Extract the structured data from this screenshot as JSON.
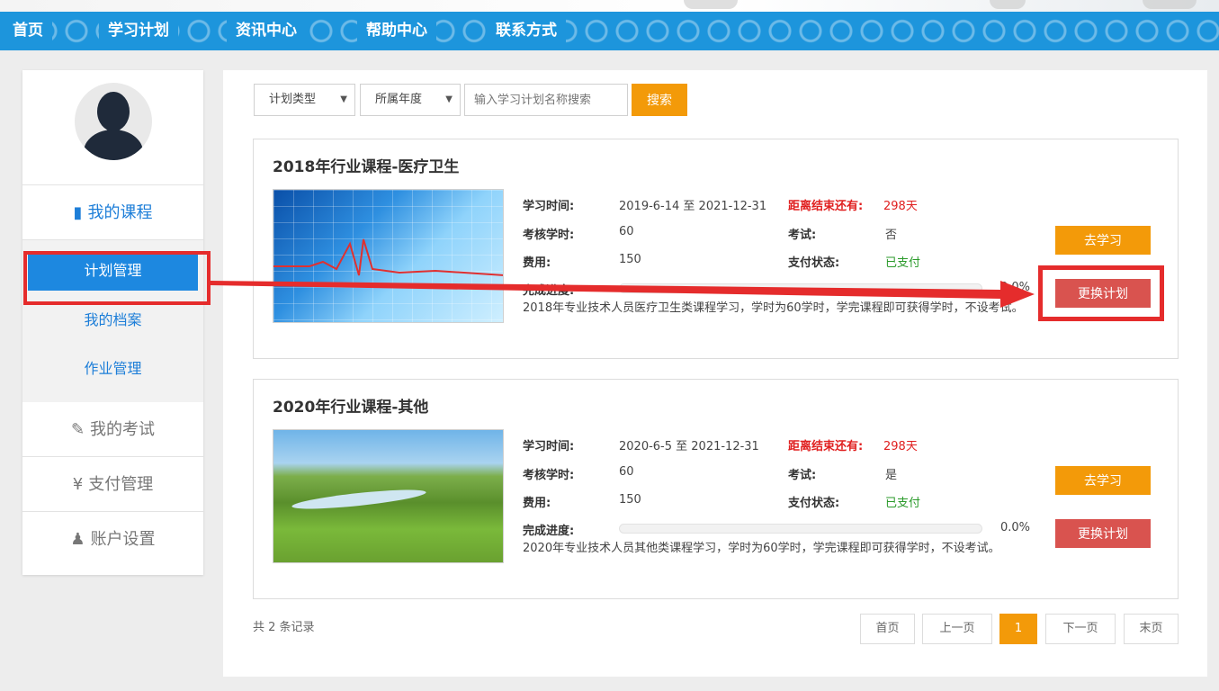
{
  "nav": {
    "items": [
      "首页",
      "学习计划",
      "资讯中心",
      "帮助中心",
      "联系方式"
    ]
  },
  "sidebar": {
    "my_courses": "我的课程",
    "sub_items": [
      "计划管理",
      "我的档案",
      "作业管理"
    ],
    "my_exams": "我的考试",
    "payment": "支付管理",
    "account": "账户设置"
  },
  "filters": {
    "plan_type": "计划类型",
    "year": "所属年度",
    "search_placeholder": "输入学习计划名称搜索",
    "search_button": "搜索"
  },
  "labels": {
    "study_time": "学习时间:",
    "remaining": "距离结束还有:",
    "credit_hours": "考核学时:",
    "exam": "考试:",
    "fee": "费用:",
    "pay_status": "支付状态:",
    "progress": "完成进度:",
    "learn_button": "去学习",
    "change_button": "更换计划"
  },
  "courses": [
    {
      "title": "2018年行业课程-医疗卫生",
      "study_time": "2019-6-14 至 2021-12-31",
      "remaining": "298天",
      "credit_hours": "60",
      "exam": "否",
      "fee": "150",
      "pay_status": "已支付",
      "progress": "0.0%",
      "description": "2018年专业技术人员医疗卫生类课程学习，学时为60学时，学完课程即可获得学时，不设考试。"
    },
    {
      "title": "2020年行业课程-其他",
      "study_time": "2020-6-5 至 2021-12-31",
      "remaining": "298天",
      "credit_hours": "60",
      "exam": "是",
      "fee": "150",
      "pay_status": "已支付",
      "progress": "0.0%",
      "description": "2020年专业技术人员其他类课程学习，学时为60学时，学完课程即可获得学时，不设考试。"
    }
  ],
  "footer": {
    "records": "共 2 条记录",
    "first": "首页",
    "prev": "上一页",
    "current": "1",
    "next": "下一页",
    "last": "末页"
  },
  "colors": {
    "nav_blue": "#1d95dc",
    "accent_orange": "#f39a09",
    "change_red": "#d9534f",
    "annotation_red": "#e52c2c"
  }
}
